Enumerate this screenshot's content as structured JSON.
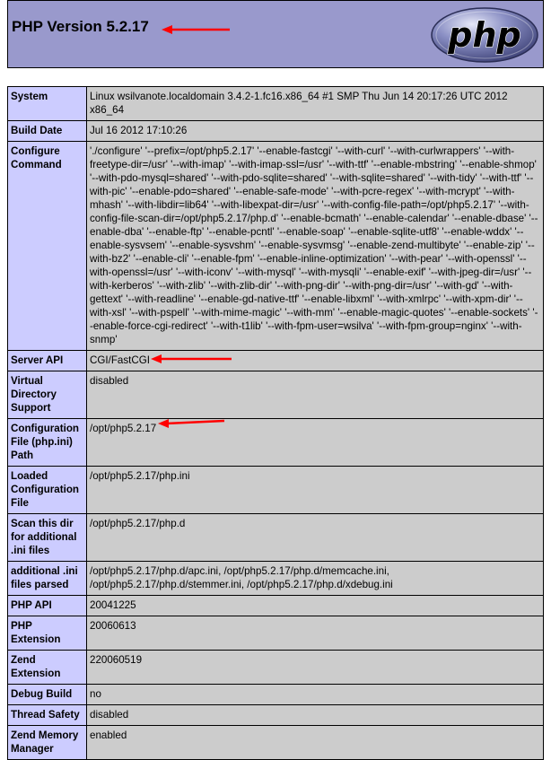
{
  "header": {
    "title": "PHP Version 5.2.17",
    "logo_text": "php",
    "bg_color": "#9999cc"
  },
  "annotation_color": "#ff0000",
  "rows": [
    {
      "label": "System",
      "value": "Linux wsilvanote.localdomain 3.4.2-1.fc16.x86_64 #1 SMP Thu Jun 14 20:17:26 UTC 2012 x86_64"
    },
    {
      "label": "Build Date",
      "value": "Jul 16 2012 17:10:26"
    },
    {
      "label": "Configure Command",
      "value": "'./configure' '--prefix=/opt/php5.2.17' '--enable-fastcgi' '--with-curl' '--with-curlwrappers' '--with-freetype-dir=/usr' '--with-imap' '--with-imap-ssl=/usr' '--with-ttf' '--enable-mbstring' '--enable-shmop' '--with-pdo-mysql=shared' '--with-pdo-sqlite=shared' '--with-sqlite=shared' '--with-tidy' '--with-ttf' '--with-pic' '--enable-pdo=shared' '--enable-safe-mode' '--with-pcre-regex' '--with-mcrypt' '--with-mhash' '--with-libdir=lib64' '--with-libexpat-dir=/usr' '--with-config-file-path=/opt/php5.2.17' '--with-config-file-scan-dir=/opt/php5.2.17/php.d' '--enable-bcmath' '--enable-calendar' '--enable-dbase' '--enable-dba' '--enable-ftp' '--enable-pcntl' '--enable-soap' '--enable-sqlite-utf8' '--enable-wddx' '--enable-sysvsem' '--enable-sysvshm' '--enable-sysvmsg' '--enable-zend-multibyte' '--enable-zip' '--with-bz2' '--enable-cli' '--enable-fpm' '--enable-inline-optimization' '--with-pear' '--with-openssl' '--with-openssl=/usr' '--with-iconv' '--with-mysql' '--with-mysqli' '--enable-exif' '--with-jpeg-dir=/usr' '--with-kerberos' '--with-zlib' '--with-zlib-dir' '--with-png-dir' '--with-png-dir=/usr' '--with-gd' '--with-gettext' '--with-readline' '--enable-gd-native-ttf' '--enable-libxml' '--with-xmlrpc' '--with-xpm-dir' '--with-xsl' '--with-pspell' '--with-mime-magic' '--with-mm' '--enable-magic-quotes' '--enable-sockets' '--enable-force-cgi-redirect' '--with-t1lib' '--with-fpm-user=wsilva' '--with-fpm-group=nginx' '--with-snmp'"
    },
    {
      "label": "Server API",
      "value": "CGI/FastCGI"
    },
    {
      "label": "Virtual Directory Support",
      "value": "disabled"
    },
    {
      "label": "Configuration File (php.ini) Path",
      "value": "/opt/php5.2.17"
    },
    {
      "label": "Loaded Configuration File",
      "value": "/opt/php5.2.17/php.ini"
    },
    {
      "label": "Scan this dir for additional .ini files",
      "value": "/opt/php5.2.17/php.d"
    },
    {
      "label": "additional .ini files parsed",
      "value": "/opt/php5.2.17/php.d/apc.ini, /opt/php5.2.17/php.d/memcache.ini, /opt/php5.2.17/php.d/stemmer.ini, /opt/php5.2.17/php.d/xdebug.ini"
    },
    {
      "label": "PHP API",
      "value": "20041225"
    },
    {
      "label": "PHP Extension",
      "value": "20060613"
    },
    {
      "label": "Zend Extension",
      "value": "220060519"
    },
    {
      "label": "Debug Build",
      "value": "no"
    },
    {
      "label": "Thread Safety",
      "value": "disabled"
    },
    {
      "label": "Zend Memory Manager",
      "value": "enabled"
    }
  ]
}
